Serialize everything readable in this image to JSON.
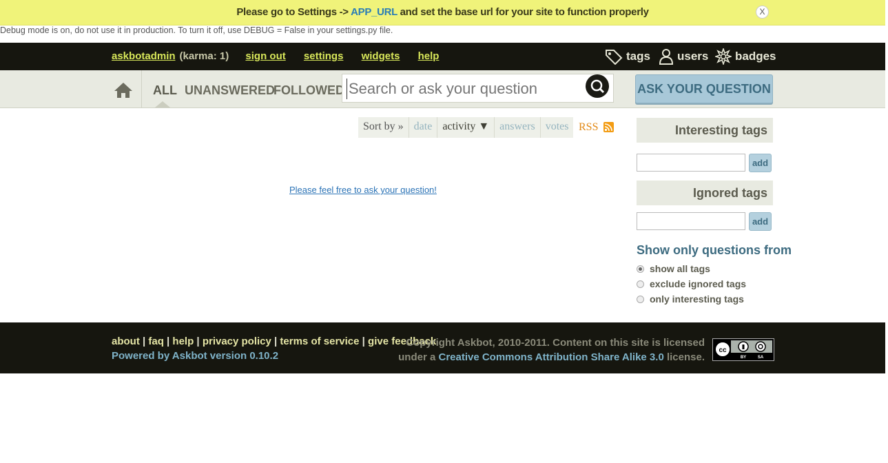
{
  "notify": {
    "prefix": "Please go to Settings -> ",
    "link": "APP_URL",
    "suffix": " and set the base url for your site to function properly",
    "close": "X"
  },
  "debug_text": "Debug mode is on, do not use it in production. To turn it off, use DEBUG = False in your settings.py file.",
  "header": {
    "username": "askbotadmin",
    "karma": "(karma: 1)",
    "links": [
      "sign out",
      "settings",
      "widgets",
      "help"
    ],
    "metanav": [
      {
        "label": "tags",
        "icon": "tag-icon"
      },
      {
        "label": "users",
        "icon": "user-icon"
      },
      {
        "label": "badges",
        "icon": "badge-icon"
      }
    ]
  },
  "scopes": [
    "ALL",
    "UNANSWERED",
    "FOLLOWED"
  ],
  "search": {
    "placeholder": "Search or ask your question"
  },
  "ask_button": "ASK YOUR QUESTION",
  "sort": {
    "label": "Sort by »",
    "options": [
      "date",
      "activity ▼",
      "answers",
      "votes"
    ],
    "current": "activity ▼",
    "rss": "RSS"
  },
  "empty_message": "Please feel free to ask your question!",
  "sidebar": {
    "interesting_title": "Interesting tags",
    "ignored_title": "Ignored tags",
    "add_label": "add",
    "show_from_title": "Show only questions from",
    "radio_options": [
      "show all tags",
      "exclude ignored tags",
      "only interesting tags"
    ],
    "selected": "show all tags"
  },
  "footer": {
    "links": [
      "about",
      "faq",
      "help",
      "privacy policy",
      "terms of service",
      "give feedback"
    ],
    "powered": "Powered by Askbot version 0.10.2",
    "copyright_line1": "Copyright Askbot, 2010-2011. Content on this site is licensed",
    "copyright_prefix": "under a ",
    "license_link": "Creative Commons Attribution Share Alike 3.0",
    "copyright_suffix": " license.",
    "cc_badge": {
      "by": "BY",
      "sa": "SA"
    }
  }
}
